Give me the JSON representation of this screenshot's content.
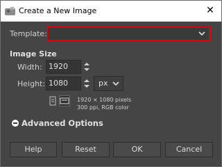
{
  "window": {
    "title": "Create a New Image"
  },
  "template": {
    "label": "Template:",
    "value": ""
  },
  "image_size": {
    "heading": "Image Size",
    "width_label": "Width:",
    "width_value": "1920",
    "height_label": "Height:",
    "height_value": "1080",
    "unit": "px",
    "dimensions_text": "1920 × 1080 pixels",
    "resolution_text": "300 ppi, RGB color"
  },
  "advanced": {
    "label": "Advanced Options"
  },
  "buttons": {
    "help": "Help",
    "reset": "Reset",
    "ok": "OK",
    "cancel": "Cancel"
  },
  "colors": {
    "accent_border": "#e00000",
    "dialog_bg": "#454545",
    "titlebar_bg": "#ffffff"
  }
}
